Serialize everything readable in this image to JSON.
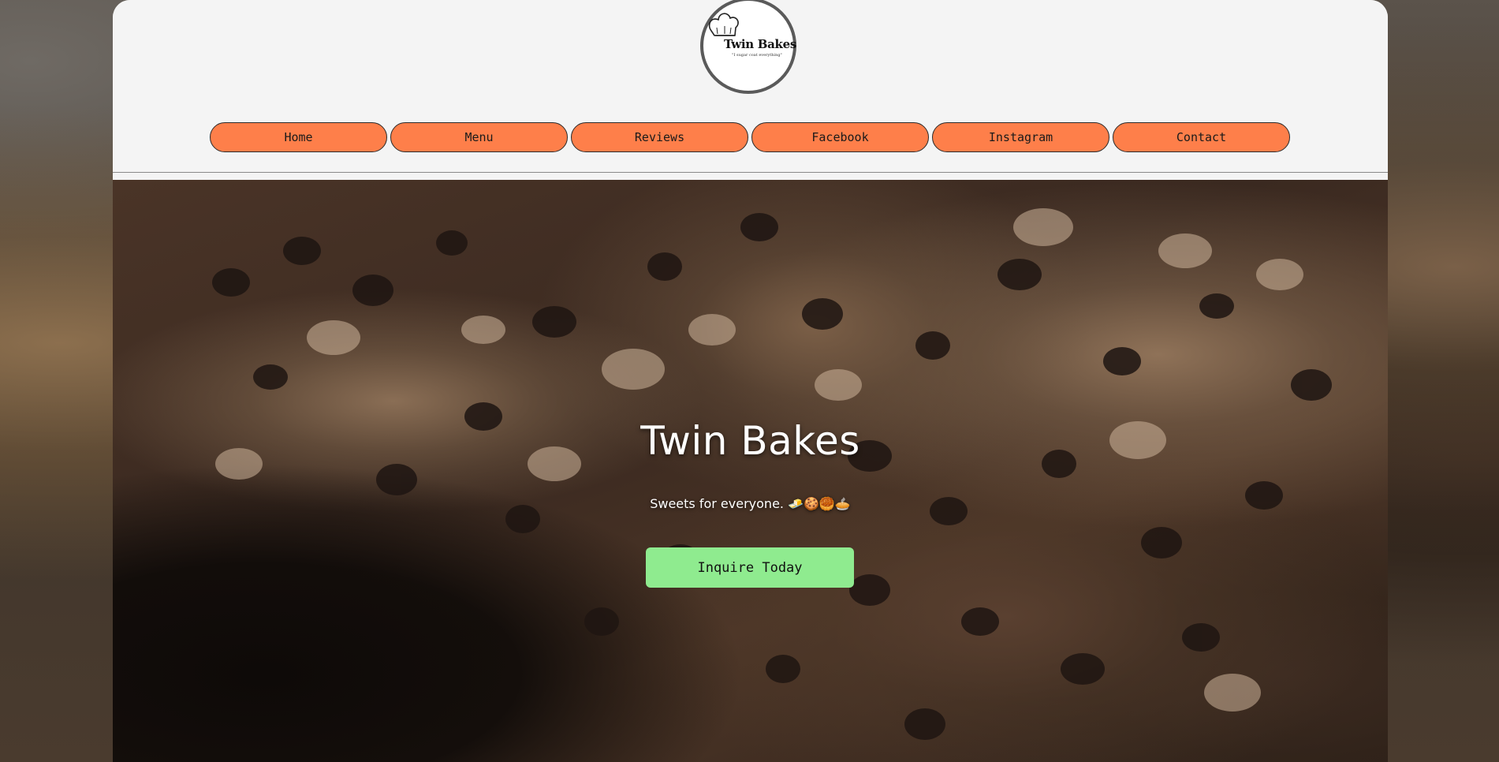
{
  "logo": {
    "title": "Twin Bakes",
    "tagline": "\"I sugar coat everything\""
  },
  "nav": {
    "items": [
      {
        "label": "Home"
      },
      {
        "label": "Menu"
      },
      {
        "label": "Reviews"
      },
      {
        "label": "Facebook"
      },
      {
        "label": "Instagram"
      },
      {
        "label": "Contact"
      }
    ]
  },
  "hero": {
    "title": "Twin Bakes",
    "subtitle": "Sweets for everyone. 🧈🍪🥮🥧",
    "cta_label": "Inquire Today"
  },
  "colors": {
    "nav_button": "#fe7f4a",
    "cta_button": "#8feb8f",
    "header_bg": "#f4f4f4"
  }
}
